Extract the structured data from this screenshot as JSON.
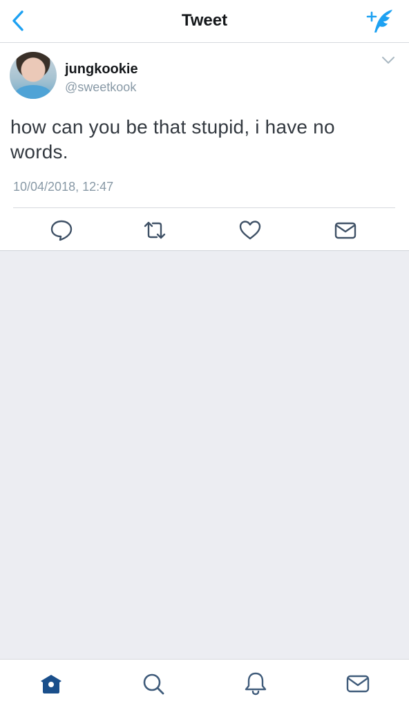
{
  "navbar": {
    "title": "Tweet",
    "back_icon": "chevron-left-icon",
    "compose_icon": "compose-feather-icon",
    "accent_color": "#1DA1F2"
  },
  "tweet": {
    "display_name": "jungkookie",
    "handle": "@sweetkook",
    "text": "how can you be that stupid, i have no words.",
    "timestamp": "10/04/2018, 12:47",
    "menu_icon": "chevron-down-icon",
    "actions": [
      {
        "name": "reply",
        "icon": "reply-bubble-icon"
      },
      {
        "name": "retweet",
        "icon": "retweet-icon"
      },
      {
        "name": "like",
        "icon": "heart-icon"
      },
      {
        "name": "direct-message",
        "icon": "envelope-icon"
      }
    ]
  },
  "tabbar": {
    "items": [
      {
        "name": "home",
        "icon": "home-icon",
        "active": true
      },
      {
        "name": "search",
        "icon": "search-icon",
        "active": false
      },
      {
        "name": "notifications",
        "icon": "bell-icon",
        "active": false
      },
      {
        "name": "messages",
        "icon": "envelope-icon",
        "active": false
      }
    ],
    "active_color": "#1A4F8B",
    "inactive_color": "#3F5B7A"
  }
}
